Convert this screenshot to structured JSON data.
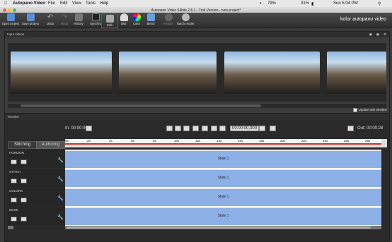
{
  "menubar": {
    "apple": "",
    "app": "Autopano Video",
    "items": [
      "File",
      "Edit",
      "View",
      "Tools",
      "Help"
    ],
    "battery": "31%",
    "clock": "Sun 5:04 PM",
    "wifi": "79%"
  },
  "window": {
    "title": "Autopano Video 64bits 2.6.1 - Trial Version - new project*"
  },
  "toolbar": {
    "buttons": [
      {
        "label": "Open project"
      },
      {
        "label": "Save project"
      },
      {
        "label": "Undo"
      },
      {
        "label": "Redo"
      },
      {
        "label": "History"
      },
      {
        "label": "Synchro"
      },
      {
        "label": "Edit"
      },
      {
        "label": "Blur"
      },
      {
        "label": "Color"
      },
      {
        "label": "Blend"
      },
      {
        "label": "Render"
      },
      {
        "label": "Batch render"
      }
    ],
    "brand": "kolor autopano video"
  },
  "input_videos": {
    "title": "Input videos",
    "update_label": "Update with timeline"
  },
  "timeline": {
    "title": "Timeline",
    "in_label": "In: 00:00:00",
    "out_label": "Out: 00:00:28",
    "timecode": "00:00:00,000",
    "tabs": [
      "Stitching",
      "Authoring"
    ],
    "ticks": [
      "0s",
      "2s",
      "4s",
      "6s",
      "8s",
      "10s",
      "12s",
      "14s",
      "16s",
      "18s",
      "20s",
      "22s",
      "24s",
      "26s",
      "28s"
    ],
    "tracks": [
      {
        "name": "HORIZON",
        "state": "State 1"
      },
      {
        "name": "STITCH",
        "state": "State 1"
      },
      {
        "name": "COLORS",
        "state": "State 1"
      },
      {
        "name": "MASK",
        "state": "State 1"
      }
    ]
  },
  "colors": {
    "accent_red": "#c0392b",
    "state_blue": "#8db0e6"
  }
}
